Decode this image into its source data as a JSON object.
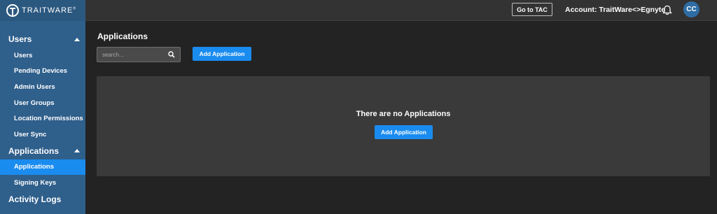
{
  "brand": {
    "name": "TRAITWARE",
    "tm": "®"
  },
  "sidebar": {
    "sections": [
      {
        "label": "Users",
        "items": [
          "Users",
          "Pending Devices",
          "Admin Users",
          "User Groups",
          "Location Permissions",
          "User Sync"
        ]
      },
      {
        "label": "Applications",
        "items": [
          "Applications",
          "Signing Keys"
        ]
      },
      {
        "label": "Activity Logs"
      }
    ],
    "active_item": "Applications"
  },
  "topbar": {
    "tac_button": "Go to TAC",
    "account": "Account: TraitWare<>Egnyte",
    "avatar_initials": "CC"
  },
  "main": {
    "title": "Applications",
    "search_placeholder": "search...",
    "add_button": "Add Application",
    "empty_message": "There are no Applications",
    "empty_add_button": "Add Application"
  },
  "colors": {
    "accent": "#1a8cf0",
    "sidebar": "#2f5f8b",
    "background": "#232323",
    "panel": "#3a3a3a"
  }
}
